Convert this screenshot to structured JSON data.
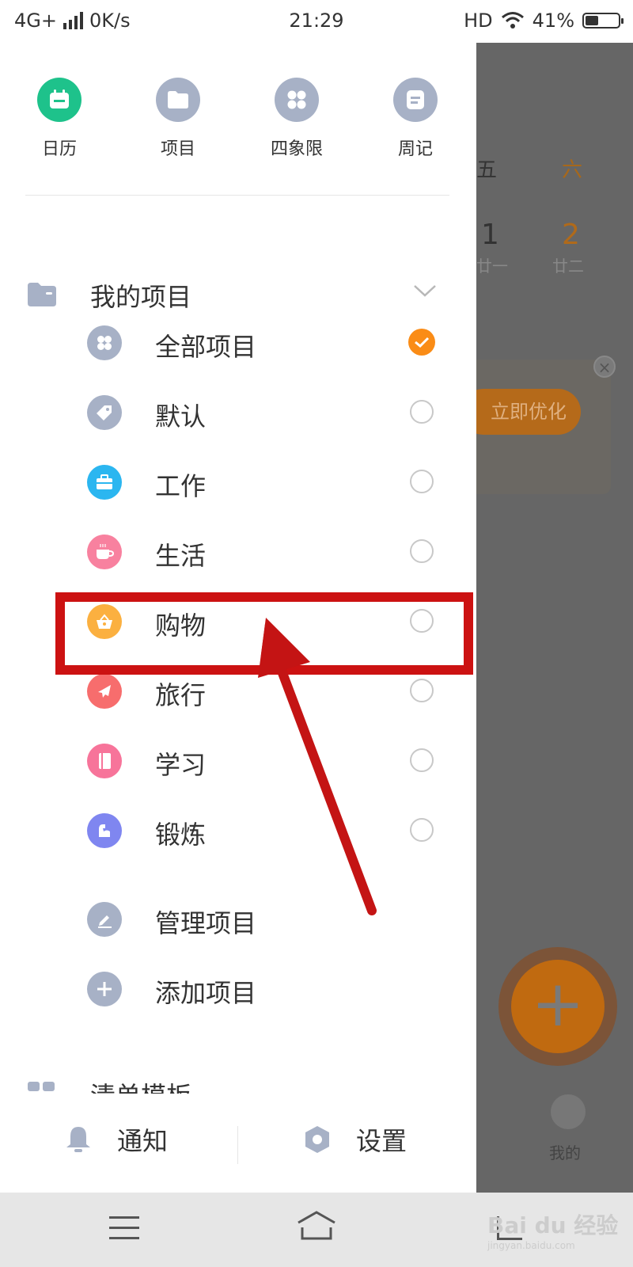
{
  "status_bar": {
    "network": "4G+",
    "speed": "0K/s",
    "time": "21:29",
    "hd": "HD",
    "battery": "41%",
    "battery_level": 0.41
  },
  "quick_actions": [
    {
      "label": "日历",
      "icon": "calendar-icon",
      "color": "#1ec28b"
    },
    {
      "label": "项目",
      "icon": "folder-icon",
      "color": "#a7b1c6"
    },
    {
      "label": "四象限",
      "icon": "quadrant-icon",
      "color": "#a7b1c6"
    },
    {
      "label": "周记",
      "icon": "note-icon",
      "color": "#a7b1c6"
    }
  ],
  "projects": {
    "title": "我的项目",
    "items": [
      {
        "label": "全部项目",
        "icon": "grid-icon",
        "color": "#a7b1c6",
        "selected": true
      },
      {
        "label": "默认",
        "icon": "tag-icon",
        "color": "#a7b1c6",
        "selected": false
      },
      {
        "label": "工作",
        "icon": "briefcase-icon",
        "color": "#2bb6f0",
        "selected": false
      },
      {
        "label": "生活",
        "icon": "cup-icon",
        "color": "#f8819f",
        "selected": false
      },
      {
        "label": "购物",
        "icon": "basket-icon",
        "color": "#fbb040",
        "selected": false
      },
      {
        "label": "旅行",
        "icon": "plane-icon",
        "color": "#f76d6d",
        "selected": false
      },
      {
        "label": "学习",
        "icon": "book-icon",
        "color": "#f7749a",
        "selected": false
      },
      {
        "label": "锻炼",
        "icon": "arm-icon",
        "color": "#7f86f0",
        "selected": false
      }
    ],
    "manage_label": "管理项目",
    "add_label": "添加项目"
  },
  "partial_section_label": "清单模板",
  "bottom": {
    "notify_label": "通知",
    "settings_label": "设置"
  },
  "background_app": {
    "weekday_fri": "五",
    "weekday_sat": "六",
    "date_fri": "1",
    "date_sat": "2",
    "lunar_fri": "廿一",
    "lunar_sat": "廿二",
    "optimize_button": "立即优化",
    "me_label": "我的"
  },
  "watermark": {
    "brand": "Bai du 经验",
    "url": "jingyan.baidu.com"
  },
  "colors": {
    "annotation_red": "#cc1212",
    "accent_orange": "#fa8c16"
  }
}
